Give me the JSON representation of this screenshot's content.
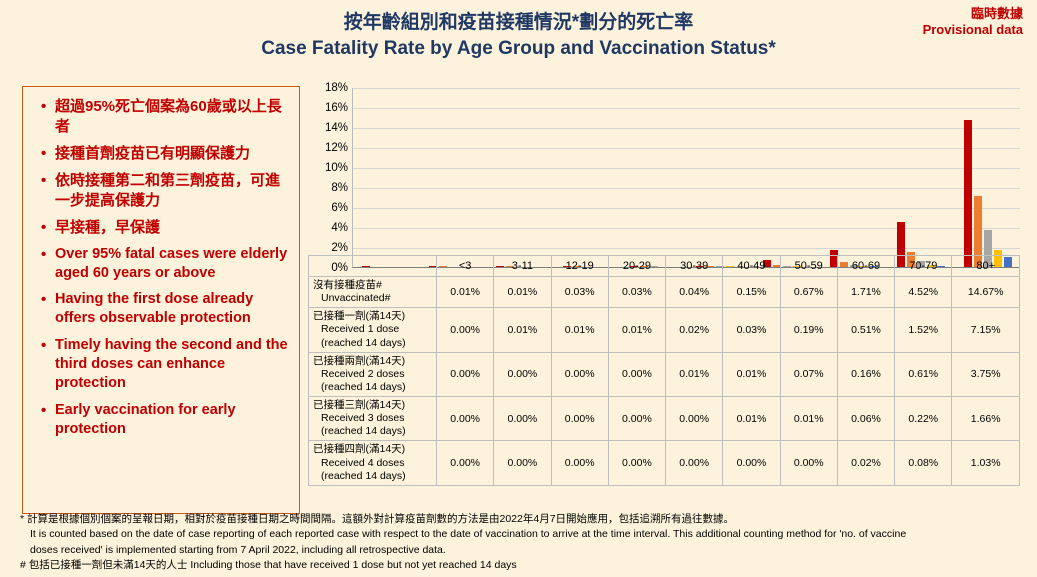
{
  "header": {
    "title_cn": "按年齡組別和疫苗接種情況*劃分的死亡率",
    "title_en": "Case Fatality Rate by Age Group and Vaccination Status*",
    "provisional_cn": "臨時數據",
    "provisional_en": "Provisional data"
  },
  "bullets": [
    {
      "text": "超過95%死亡個案為60歲或以上長者",
      "lang": "cn"
    },
    {
      "text": "接種首劑疫苗已有明顯保護力",
      "lang": "cn"
    },
    {
      "text": "依時接種第二和第三劑疫苗，可進一步提高保護力",
      "lang": "cn"
    },
    {
      "text": "早接種，早保護",
      "lang": "cn"
    },
    {
      "text": "Over 95% fatal cases were elderly aged 60 years or above",
      "lang": "en"
    },
    {
      "text": "Having the first dose already offers observable protection",
      "lang": "en"
    },
    {
      "text": "Timely having the second and the third doses can enhance protection",
      "lang": "en"
    },
    {
      "text": "Early vaccination for early protection",
      "lang": "en"
    }
  ],
  "chart_data": {
    "type": "bar",
    "title": "Case Fatality Rate by Age Group and Vaccination Status",
    "xlabel": "",
    "ylabel": "",
    "ylim": [
      0,
      18
    ],
    "yticks": [
      "0%",
      "2%",
      "4%",
      "6%",
      "8%",
      "10%",
      "12%",
      "14%",
      "16%",
      "18%"
    ],
    "grid": true,
    "legend_position": "none",
    "categories": [
      "<3",
      "3-11",
      "12-19",
      "20-29",
      "30-39",
      "40-49",
      "50-59",
      "60-69",
      "70-79",
      "80+"
    ],
    "series": [
      {
        "name": "沒有接種疫苗# / Unvaccinated#",
        "color": "#c00000",
        "values": [
          0.01,
          0.01,
          0.03,
          0.03,
          0.04,
          0.15,
          0.67,
          1.71,
          4.52,
          14.67
        ],
        "labels": [
          "0.01%",
          "0.01%",
          "0.03%",
          "0.03%",
          "0.04%",
          "0.15%",
          "0.67%",
          "1.71%",
          "4.52%",
          "14.67%"
        ]
      },
      {
        "name": "已接種一劑(滿14天) / Received 1 dose (reached 14 days)",
        "color": "#ed7d31",
        "values": [
          0.0,
          0.01,
          0.01,
          0.01,
          0.02,
          0.03,
          0.19,
          0.51,
          1.52,
          7.15
        ],
        "labels": [
          "0.00%",
          "0.01%",
          "0.01%",
          "0.01%",
          "0.02%",
          "0.03%",
          "0.19%",
          "0.51%",
          "1.52%",
          "7.15%"
        ]
      },
      {
        "name": "已接種兩劑(滿14天) / Received 2 doses (reached 14 days)",
        "color": "#a6a6a6",
        "values": [
          0.0,
          0.0,
          0.0,
          0.0,
          0.01,
          0.01,
          0.07,
          0.16,
          0.61,
          3.75
        ],
        "labels": [
          "0.00%",
          "0.00%",
          "0.00%",
          "0.00%",
          "0.01%",
          "0.01%",
          "0.07%",
          "0.16%",
          "0.61%",
          "3.75%"
        ]
      },
      {
        "name": "已接種三劑(滿14天) / Received 3 doses (reached 14 days)",
        "color": "#ffc000",
        "values": [
          0.0,
          0.0,
          0.0,
          0.0,
          0.0,
          0.01,
          0.01,
          0.06,
          0.22,
          1.66
        ],
        "labels": [
          "0.00%",
          "0.00%",
          "0.00%",
          "0.00%",
          "0.00%",
          "0.01%",
          "0.01%",
          "0.06%",
          "0.22%",
          "1.66%"
        ]
      },
      {
        "name": "已接種四劑(滿14天) / Received 4 doses (reached 14 days)",
        "color": "#4472c4",
        "values": [
          0.0,
          0.0,
          0.0,
          0.0,
          0.0,
          0.0,
          0.0,
          0.02,
          0.08,
          1.03
        ],
        "labels": [
          "0.00%",
          "0.00%",
          "0.00%",
          "0.00%",
          "0.00%",
          "0.00%",
          "0.00%",
          "0.02%",
          "0.08%",
          "1.03%"
        ]
      }
    ]
  },
  "table": {
    "columns": [
      "<3",
      "3-11",
      "12-19",
      "20-29",
      "30-39",
      "40-49",
      "50-59",
      "60-69",
      "70-79",
      "80+"
    ],
    "rows": [
      {
        "label_cn": "沒有接種疫苗#",
        "label_en": "Unvaccinated#",
        "values": [
          "0.01%",
          "0.01%",
          "0.03%",
          "0.03%",
          "0.04%",
          "0.15%",
          "0.67%",
          "1.71%",
          "4.52%",
          "14.67%"
        ]
      },
      {
        "label_cn": "已接種一劑(滿14天)",
        "label_en": "Received 1 dose\n(reached 14 days)",
        "values": [
          "0.00%",
          "0.01%",
          "0.01%",
          "0.01%",
          "0.02%",
          "0.03%",
          "0.19%",
          "0.51%",
          "1.52%",
          "7.15%"
        ]
      },
      {
        "label_cn": "已接種兩劑(滿14天)",
        "label_en": "Received 2 doses\n(reached 14 days)",
        "values": [
          "0.00%",
          "0.00%",
          "0.00%",
          "0.00%",
          "0.01%",
          "0.01%",
          "0.07%",
          "0.16%",
          "0.61%",
          "3.75%"
        ]
      },
      {
        "label_cn": "已接種三劑(滿14天)",
        "label_en": "Received 3 doses\n(reached 14 days)",
        "values": [
          "0.00%",
          "0.00%",
          "0.00%",
          "0.00%",
          "0.00%",
          "0.01%",
          "0.01%",
          "0.06%",
          "0.22%",
          "1.66%"
        ]
      },
      {
        "label_cn": "已接種四劑(滿14天)",
        "label_en": "Received 4 doses\n(reached 14 days)",
        "values": [
          "0.00%",
          "0.00%",
          "0.00%",
          "0.00%",
          "0.00%",
          "0.00%",
          "0.00%",
          "0.02%",
          "0.08%",
          "1.03%"
        ]
      }
    ]
  },
  "footnotes": [
    {
      "text": "* 計算是根據個別個案的呈報日期，相對於疫苗接種日期之時間間隔。這額外對計算疫苗劑數的方法是由2022年4月7日開始應用，包括追溯所有過往數據。",
      "indent": false
    },
    {
      "text": "It is counted based on the date of case reporting of each reported case with respect to the date of vaccination to arrive at the time interval. This additional counting method for 'no. of vaccine",
      "indent": true
    },
    {
      "text": "doses received' is implemented starting from 7 April 2022, including all retrospective data.",
      "indent": true
    },
    {
      "text": "# 包括已接種一劑但未滿14天的人士 Including those that have received 1 dose but not yet reached 14 days",
      "indent": false
    }
  ]
}
